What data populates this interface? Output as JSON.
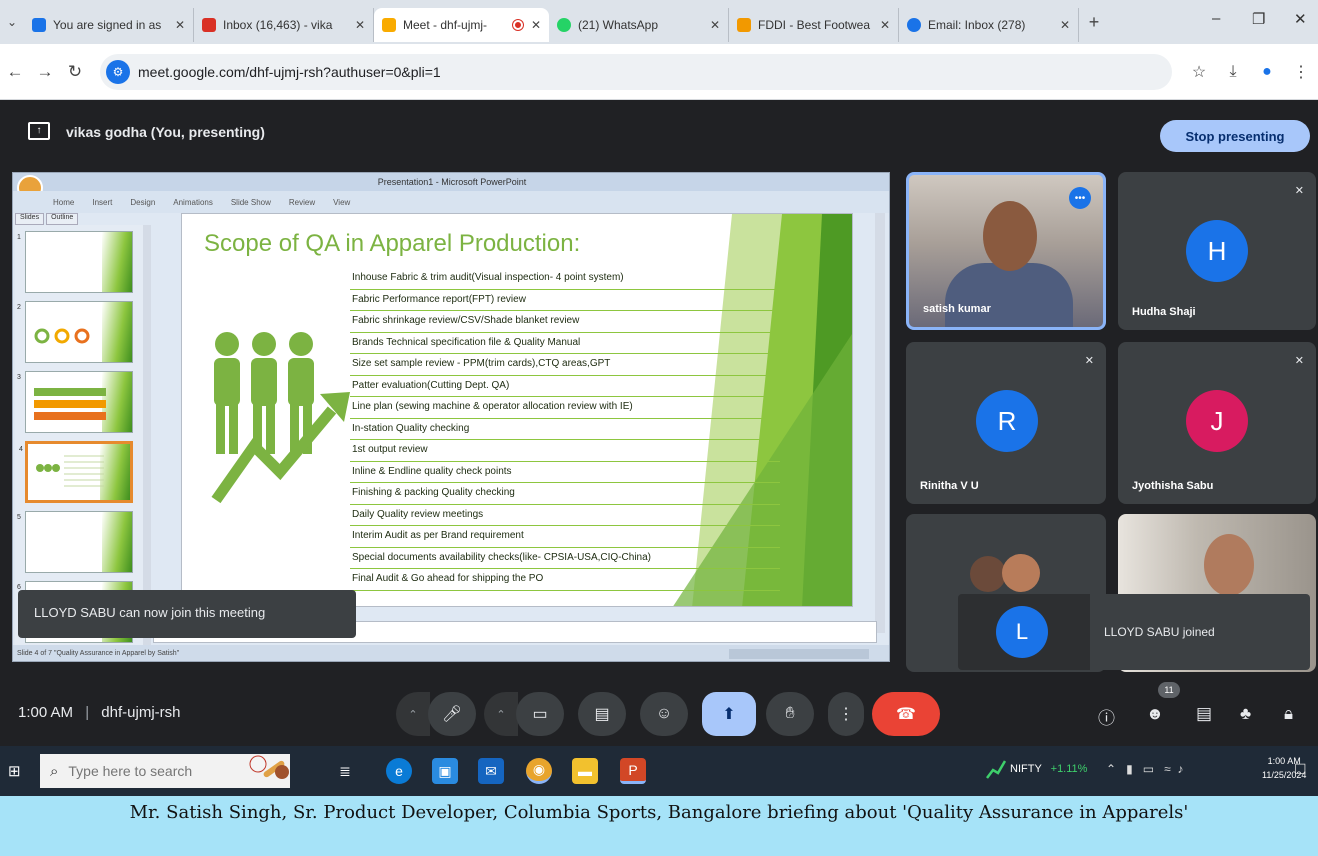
{
  "browser": {
    "tabs": [
      {
        "label": "You are signed in as",
        "color": "#1a73e8"
      },
      {
        "label": "Inbox (16,463) - vika",
        "color": "#d93025"
      },
      {
        "label": "Meet - dhf-ujmj-",
        "color": "#f9ab00",
        "active": true
      },
      {
        "label": "(21) WhatsApp",
        "color": "#25d366"
      },
      {
        "label": "FDDI - Best Footwea",
        "color": "#f29900"
      },
      {
        "label": "Email: Inbox (278)",
        "color": "#1a73e8"
      }
    ],
    "url": "meet.google.com/dhf-ujmj-rsh?authuser=0&pli=1"
  },
  "meet": {
    "presenter_banner": "vikas godha (You, presenting)",
    "stop_presenting": "Stop presenting",
    "meeting_time": "1:00 AM",
    "meeting_code": "dhf-ujmj-rsh",
    "participant_count": "11",
    "toast": "LLOYD SABU can now join this meeting",
    "join_toast": {
      "initial": "L",
      "text": "LLOYD SABU joined"
    },
    "participants": [
      {
        "name": "satish kumar",
        "type": "video",
        "speaking": true
      },
      {
        "name": "Hudha Shaji",
        "initial": "H",
        "avatar_color": "#1a73e8",
        "muted": true
      },
      {
        "name": "Rinitha V U",
        "initial": "R",
        "avatar_color": "#1a73e8",
        "muted": true
      },
      {
        "name": "Jyothisha Sabu",
        "initial": "J",
        "avatar_color": "#d81b60",
        "muted": true
      }
    ]
  },
  "presentation": {
    "window_title": "Presentation1 - Microsoft PowerPoint",
    "ribbon_tabs": [
      "Home",
      "Insert",
      "Design",
      "Animations",
      "Slide Show",
      "Review",
      "View"
    ],
    "panel_tabs": [
      "Slides",
      "Outline"
    ],
    "status": "Slide 4 of 7   \"Quality Assurance in Apparel by Satish\"",
    "slide": {
      "title": "Scope of QA in Apparel Production:",
      "bullets": [
        "Inhouse Fabric & trim audit(Visual inspection- 4 point system)",
        "Fabric Performance report(FPT) review",
        "Fabric shrinkage review/CSV/Shade blanket review",
        "Brands Technical specification file & Quality Manual",
        "Size set sample review - PPM(trim cards),CTQ areas,GPT",
        "Patter evaluation(Cutting Dept. QA)",
        "Line plan (sewing machine & operator allocation review with IE)",
        "In-station Quality checking",
        "1st output review",
        "Inline & Endline quality check points",
        "Finishing & packing Quality checking",
        "Daily Quality review meetings",
        "Interim Audit as per Brand requirement",
        "Special documents availability checks(like- CPSIA-USA,CIQ-China)",
        "Final Audit & Go ahead for shipping the PO"
      ]
    }
  },
  "taskbar": {
    "search_placeholder": "Type here to search",
    "nifty_label": "NIFTY",
    "nifty_change": "+1.11%",
    "time": "1:00 AM",
    "date": "11/25/2024"
  },
  "caption": "Mr. Satish Singh, Sr. Product Developer, Columbia Sports, Bangalore briefing about 'Quality Assurance in Apparels'"
}
